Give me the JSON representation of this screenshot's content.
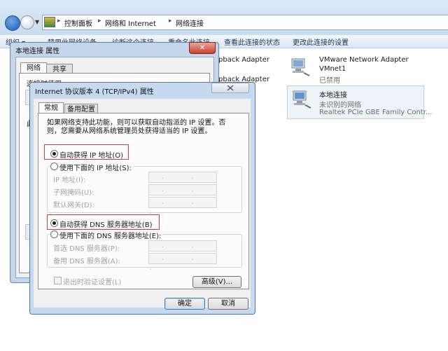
{
  "explorer": {
    "breadcrumb": [
      "控制面板",
      "网络和 Internet",
      "网络连接"
    ],
    "toolbar": [
      "组织 ▾",
      "禁用此网络设备",
      "诊断这个连接",
      "重命名此连接",
      "查看此连接的状态",
      "更改此连接的设置"
    ]
  },
  "adapters": [
    {
      "name": "Loopback Adapter",
      "visible_text": "pback Adapter"
    },
    {
      "name": "Loopback Adapter",
      "visible_text": "pback Adapter"
    },
    {
      "name": "VMware Network Adapter VMnet1",
      "line1": "VMware Network Adapter",
      "line2": "VMnet1",
      "status": "已禁用"
    },
    {
      "name": "本地连接",
      "status": "未识别的网络",
      "device": "Realtek PCIe GBE Family Contr..."
    }
  ],
  "properties_window": {
    "title": "本地连接 属性",
    "close_label": "✕",
    "tabs": [
      "网络",
      "共享"
    ],
    "partial_texts": [
      "连接时使用:",
      "此"
    ]
  },
  "ipv4_dialog": {
    "title": "Internet 协议版本 4 (TCP/IPv4) 属性",
    "tabs": [
      "常规",
      "备用配置"
    ],
    "intro": "如果网络支持此功能，则可以获取自动指派的 IP 设置。否则，您需要从网络系统管理员处获得适当的 IP 设置。",
    "ip_auto_label": "自动获得 IP 地址(O)",
    "ip_manual_label": "使用下面的 IP 地址(S):",
    "ip_fields": [
      "IP 地址(I):",
      "子网掩码(U):",
      "默认网关(D):"
    ],
    "dns_auto_label": "自动获得 DNS 服务器地址(B)",
    "dns_manual_label": "使用下面的 DNS 服务器地址(E):",
    "dns_fields": [
      "首选 DNS 服务器(P):",
      "备用 DNS 服务器(A):"
    ],
    "ip_placeholder": ". . .",
    "validate_label": "退出时验证设置(L)",
    "advanced_label": "高级(V)...",
    "ok_label": "确定",
    "cancel_label": "取消"
  },
  "colors": {
    "highlight_border": "#d0413a",
    "title_bar": "#c6d9ee"
  }
}
